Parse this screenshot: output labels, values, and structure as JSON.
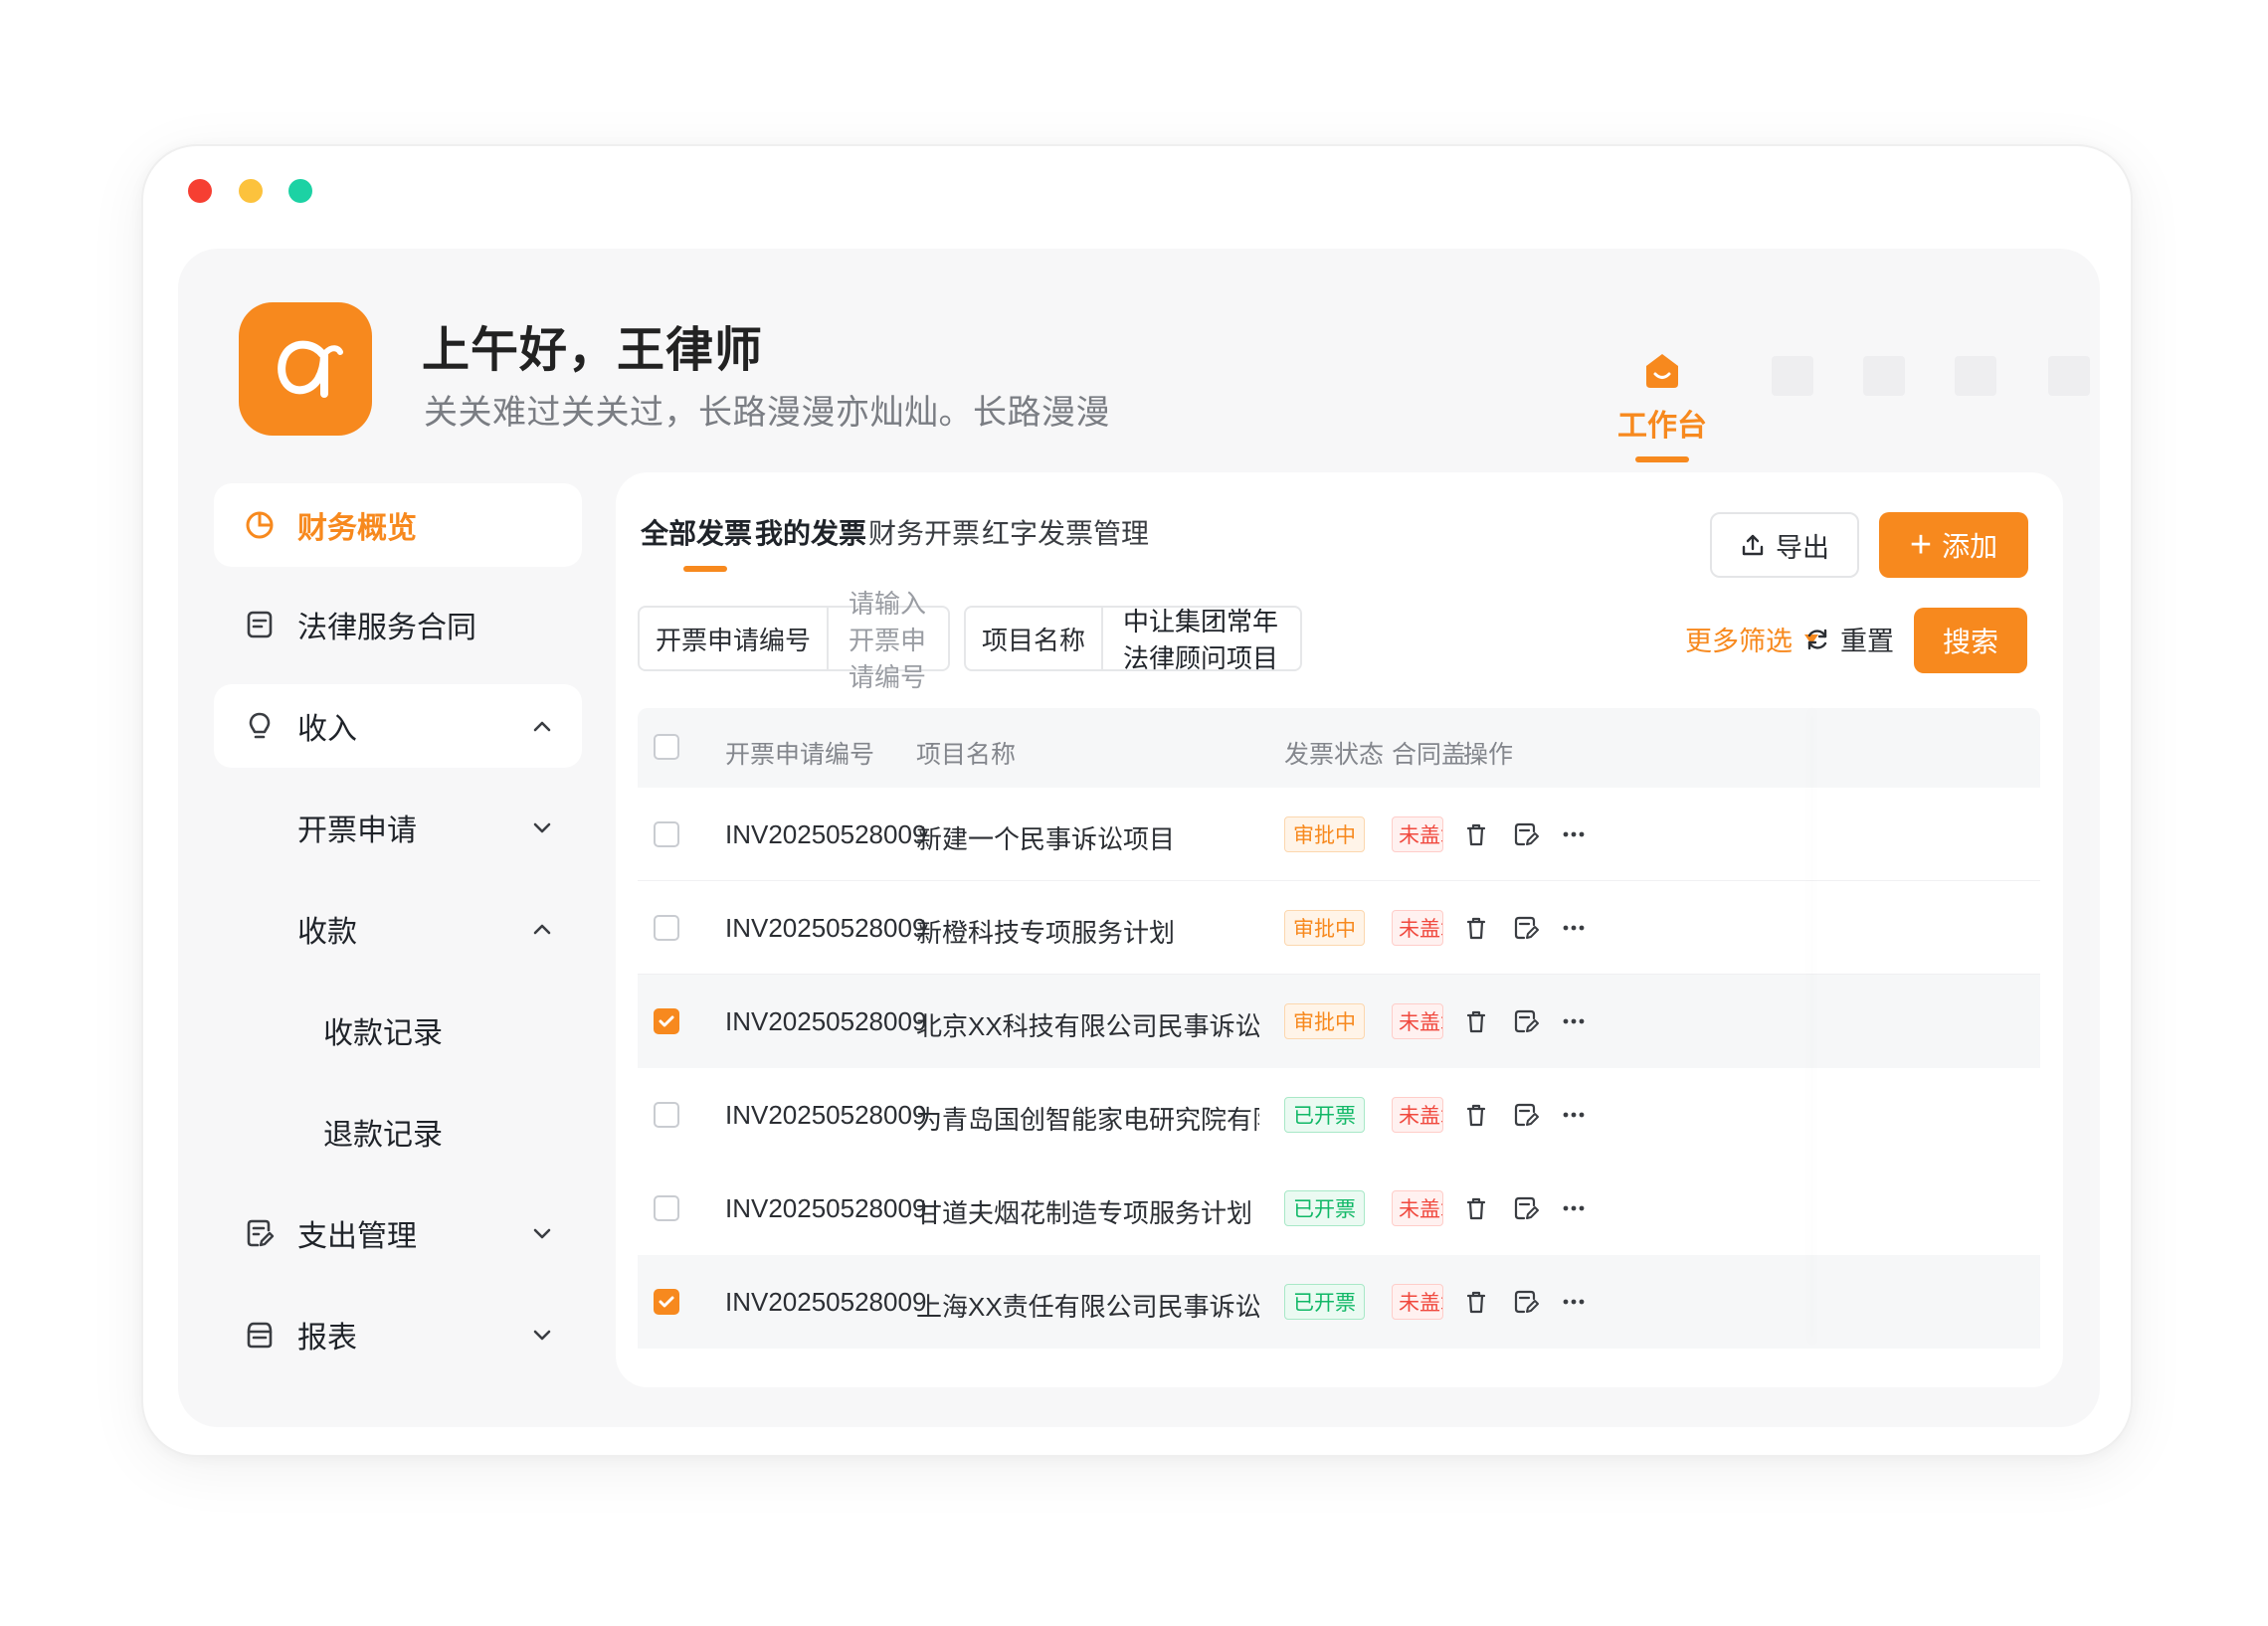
{
  "window": {
    "dots": [
      "red",
      "yellow",
      "green"
    ]
  },
  "header": {
    "greeting": "上午好，王律师",
    "subtitle": "关关难过关关过，长路漫漫亦灿灿。长路漫漫",
    "nav_label": "工作台"
  },
  "sidebar": {
    "items": [
      {
        "label": "财务概览",
        "icon": "pie-chart-icon"
      },
      {
        "label": "法律服务合同",
        "icon": "document-icon"
      },
      {
        "label": "收入",
        "icon": "lightbulb-icon"
      },
      {
        "label": "开票申请"
      },
      {
        "label": "收款"
      },
      {
        "label": "收款记录"
      },
      {
        "label": "退款记录"
      },
      {
        "label": "支出管理",
        "icon": "edit-document-icon"
      },
      {
        "label": "报表",
        "icon": "report-box-icon"
      }
    ]
  },
  "tabs": [
    "全部发票",
    "我的发票",
    "财务开票",
    "红字发票管理"
  ],
  "actions": {
    "export_label": "导出",
    "add_label": "添加",
    "add_icon": "+"
  },
  "filters": {
    "invoice_no_label": "开票申请编号",
    "invoice_no_placeholder": "请输入开票申请编号",
    "project_label": "项目名称",
    "project_value": "中让集团常年法律顾问项目",
    "more_label": "更多筛选",
    "reset_label": "重置",
    "search_label": "搜索"
  },
  "table": {
    "headers": [
      "开票申请编号",
      "项目名称",
      "发票状态",
      "合同盖",
      "操作"
    ],
    "rows": [
      {
        "checked": false,
        "id": "INV20250528009",
        "project": "新建一个民事诉讼项目",
        "status": "审批中",
        "status_color": "orange",
        "seal": "未盖章"
      },
      {
        "checked": false,
        "id": "INV20250528009",
        "project": "新橙科技专项服务计划",
        "status": "审批中",
        "status_color": "orange",
        "seal": "未盖章"
      },
      {
        "checked": true,
        "id": "INV20250528009",
        "project": "北京XX科技有限公司民事诉讼案",
        "status": "审批中",
        "status_color": "orange",
        "seal": "未盖章"
      },
      {
        "checked": false,
        "id": "INV20250528009",
        "project": "为青岛国创智能家电研究院有限公司提供…",
        "status": "已开票",
        "status_color": "green",
        "seal": "未盖章"
      },
      {
        "checked": false,
        "id": "INV20250528009",
        "project": "甘道夫烟花制造专项服务计划",
        "status": "已开票",
        "status_color": "green",
        "seal": "未盖章"
      },
      {
        "checked": true,
        "id": "INV20250528009",
        "project": "上海XX责任有限公司民事诉讼项目",
        "status": "已开票",
        "status_color": "green",
        "seal": "未盖章"
      }
    ]
  },
  "colors": {
    "accent": "#f7891e",
    "approving": "#f7891e",
    "issued": "#11b867",
    "unsealed": "#f0493e"
  }
}
